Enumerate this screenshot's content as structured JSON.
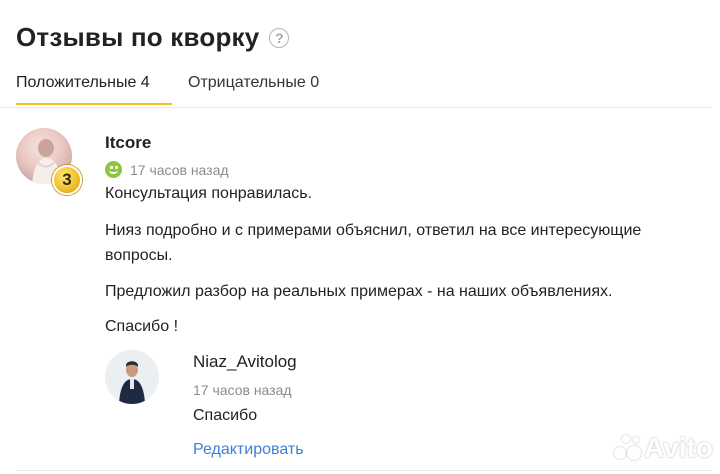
{
  "header": {
    "title": "Отзывы по кворку",
    "help_icon": "question-circle-icon"
  },
  "tabs": [
    {
      "label": "Положительные 4",
      "active": true
    },
    {
      "label": "Отрицательные 0",
      "active": false
    }
  ],
  "review": {
    "author": "Itcore",
    "level_badge": "3",
    "rating_icon": "smile-positive-icon",
    "time": "17 часов назад",
    "paragraphs": [
      "Консультация понравилась.",
      "Нияз подробно и с примерами объяснил, ответил на все интересующие",
      "вопросы.",
      "Предложил разбор на реальных примерах - на наших объявлениях.",
      "Спасибо !"
    ]
  },
  "reply": {
    "author": "Niaz_Avitolog",
    "time": "17 часов назад",
    "text": "Спасибо",
    "edit_label": "Редактировать"
  },
  "watermark": {
    "text": "Avito"
  },
  "colors": {
    "tab_underline": "#f0c419",
    "link": "#3d80d5",
    "positive": "#8cc63f",
    "muted": "#8c8c8c"
  }
}
